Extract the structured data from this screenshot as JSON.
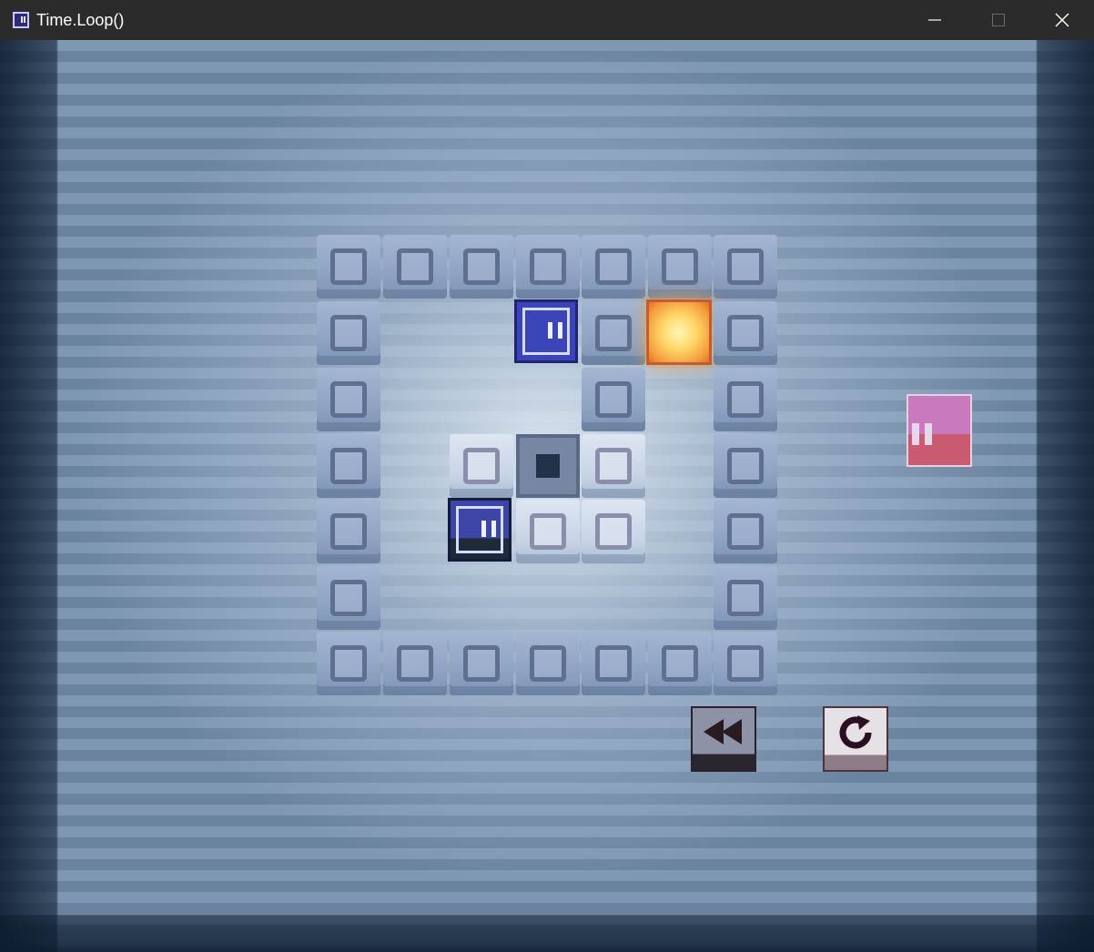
{
  "window": {
    "title": "Time.Loop()",
    "controls": [
      "minimize",
      "maximize",
      "close"
    ]
  },
  "icons": {
    "app": "app-icon",
    "minimize": "minimize-icon",
    "maximize": "maximize-icon",
    "close": "close-icon",
    "rewind": "rewind-icon",
    "restart": "restart-icon"
  },
  "board": {
    "cols": 7,
    "rows": 7,
    "wall_color": "#8fa4c4",
    "floor_color": "#d9e3ef",
    "player_color": "#3c45b8",
    "goal_color": "#ffd86a",
    "next_block_color": "#c979bd"
  }
}
